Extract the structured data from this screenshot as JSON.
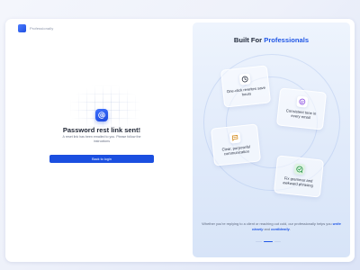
{
  "brand": {
    "name": "Professionally",
    "logo_icon": "brand-logo-icon"
  },
  "left": {
    "title": "Password rest link sent!",
    "description": "A reset link has been emailed to you. Please follow the instructions",
    "back_button": "Back to login",
    "success_icon": "at-sign-icon"
  },
  "right": {
    "title_prefix": "Built For",
    "title_accent": "Professionals",
    "cards": [
      {
        "icon": "clock-icon",
        "label": "One-click rewrites save hours"
      },
      {
        "icon": "smile-icon",
        "label": "Consistent tone in every email"
      },
      {
        "icon": "chat-icon",
        "label": "Clear, purposeful communication"
      },
      {
        "icon": "check-chat-icon",
        "label": "Fix grammar and awkward phrasing"
      }
    ],
    "description_start": "Whether you're replying to a client or reaching out cold, our professionally helps you",
    "description_em1": "write clearly",
    "description_mid": "and",
    "description_em2": "confidently",
    "description_end": ".",
    "carousel": {
      "count": 3,
      "active": 1
    }
  },
  "colors": {
    "accent": "#1b4fe0",
    "panel": "#e0eafa"
  }
}
